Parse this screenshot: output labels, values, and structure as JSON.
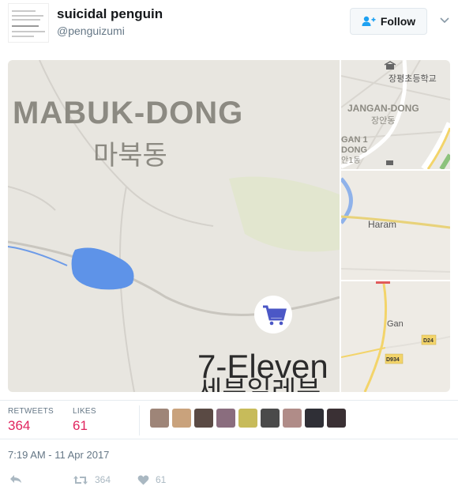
{
  "user": {
    "display_name": "suicidal penguin",
    "handle": "@penguizumi"
  },
  "follow_button": {
    "label": "Follow"
  },
  "media": {
    "main_tile": {
      "district_en": "MABUK-DONG",
      "district_ko": "마북동",
      "poi": "7-Eleven",
      "poi_ko": "세븐일레븐"
    },
    "tile_top_right": {
      "school": "장평초등학교",
      "district_en": "JANGAN-DONG",
      "district_ko": "장안동",
      "partial_en_1": "GAN 1",
      "partial_en_2": "DONG",
      "partial_ko": "안1동"
    },
    "tile_middle_right": {
      "place": "Haram"
    },
    "tile_bottom_right": {
      "place": "Gan",
      "road_1": "D24",
      "road_2": "D934"
    }
  },
  "stats": {
    "retweets_label": "RETWEETS",
    "retweets_count": "364",
    "likes_label": "LIKES",
    "likes_count": "61"
  },
  "timestamp": "7:19 AM - 11 Apr 2017",
  "actions": {
    "retweet_count": "364",
    "like_count": "61"
  },
  "colors": {
    "accent": "#e0245e",
    "map_bg": "#e9e6e0",
    "water": "#5e93e8",
    "road_yellow": "#f3d46a",
    "muted": "#657786"
  }
}
